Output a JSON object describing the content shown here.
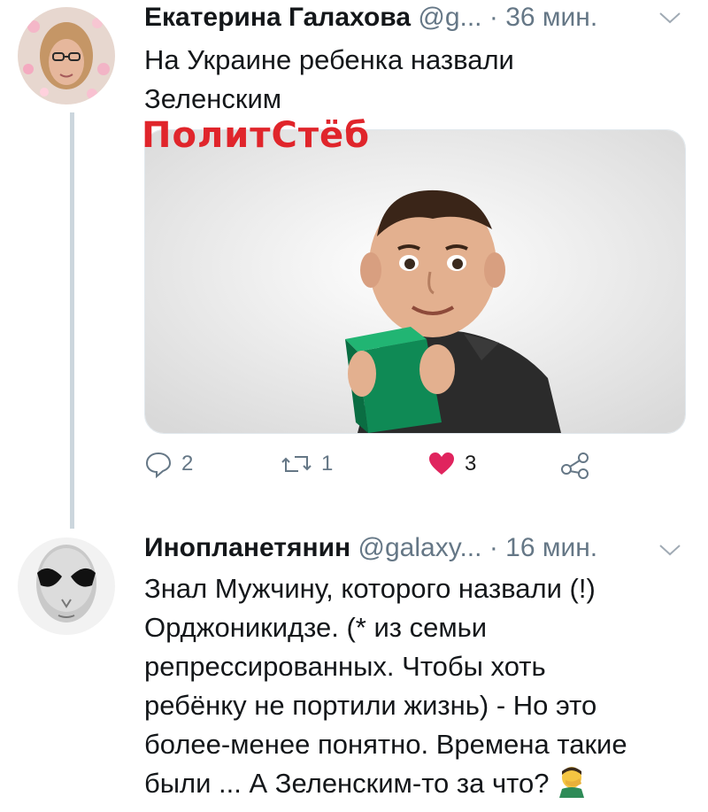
{
  "tweets": [
    {
      "author_name": "Екатерина Галахова",
      "handle": "@g...",
      "separator": "·",
      "time": "36 мин.",
      "text_lines": [
        "На Украине ребенка назвали",
        "Зеленским"
      ],
      "media_overlay_text": "ПолитСтёб",
      "actions": {
        "replies": "2",
        "retweets": "1",
        "likes": "3"
      }
    },
    {
      "author_name": "Инопланетянин",
      "handle": "@galaxy...",
      "separator": "·",
      "time": "16 мин.",
      "text_lines": [
        "Знал Мужчину, которого назвали (!)",
        "Орджоникидзе. (* из семьи",
        "репрессированных. Чтобы хоть",
        "ребёнку не портили жизнь) - Но это",
        "более-менее понятно. Времена такие",
        "были ... А Зеленским-то за что?"
      ]
    }
  ],
  "colors": {
    "text": "#14171a",
    "muted": "#657786",
    "like": "#e0245e",
    "overlay": "#e0252b",
    "thread_line": "#ccd6dd"
  },
  "icons": [
    "reply-icon",
    "retweet-icon",
    "heart-icon",
    "share-icon",
    "chevron-down-icon",
    "facepalm-emoji-icon"
  ]
}
